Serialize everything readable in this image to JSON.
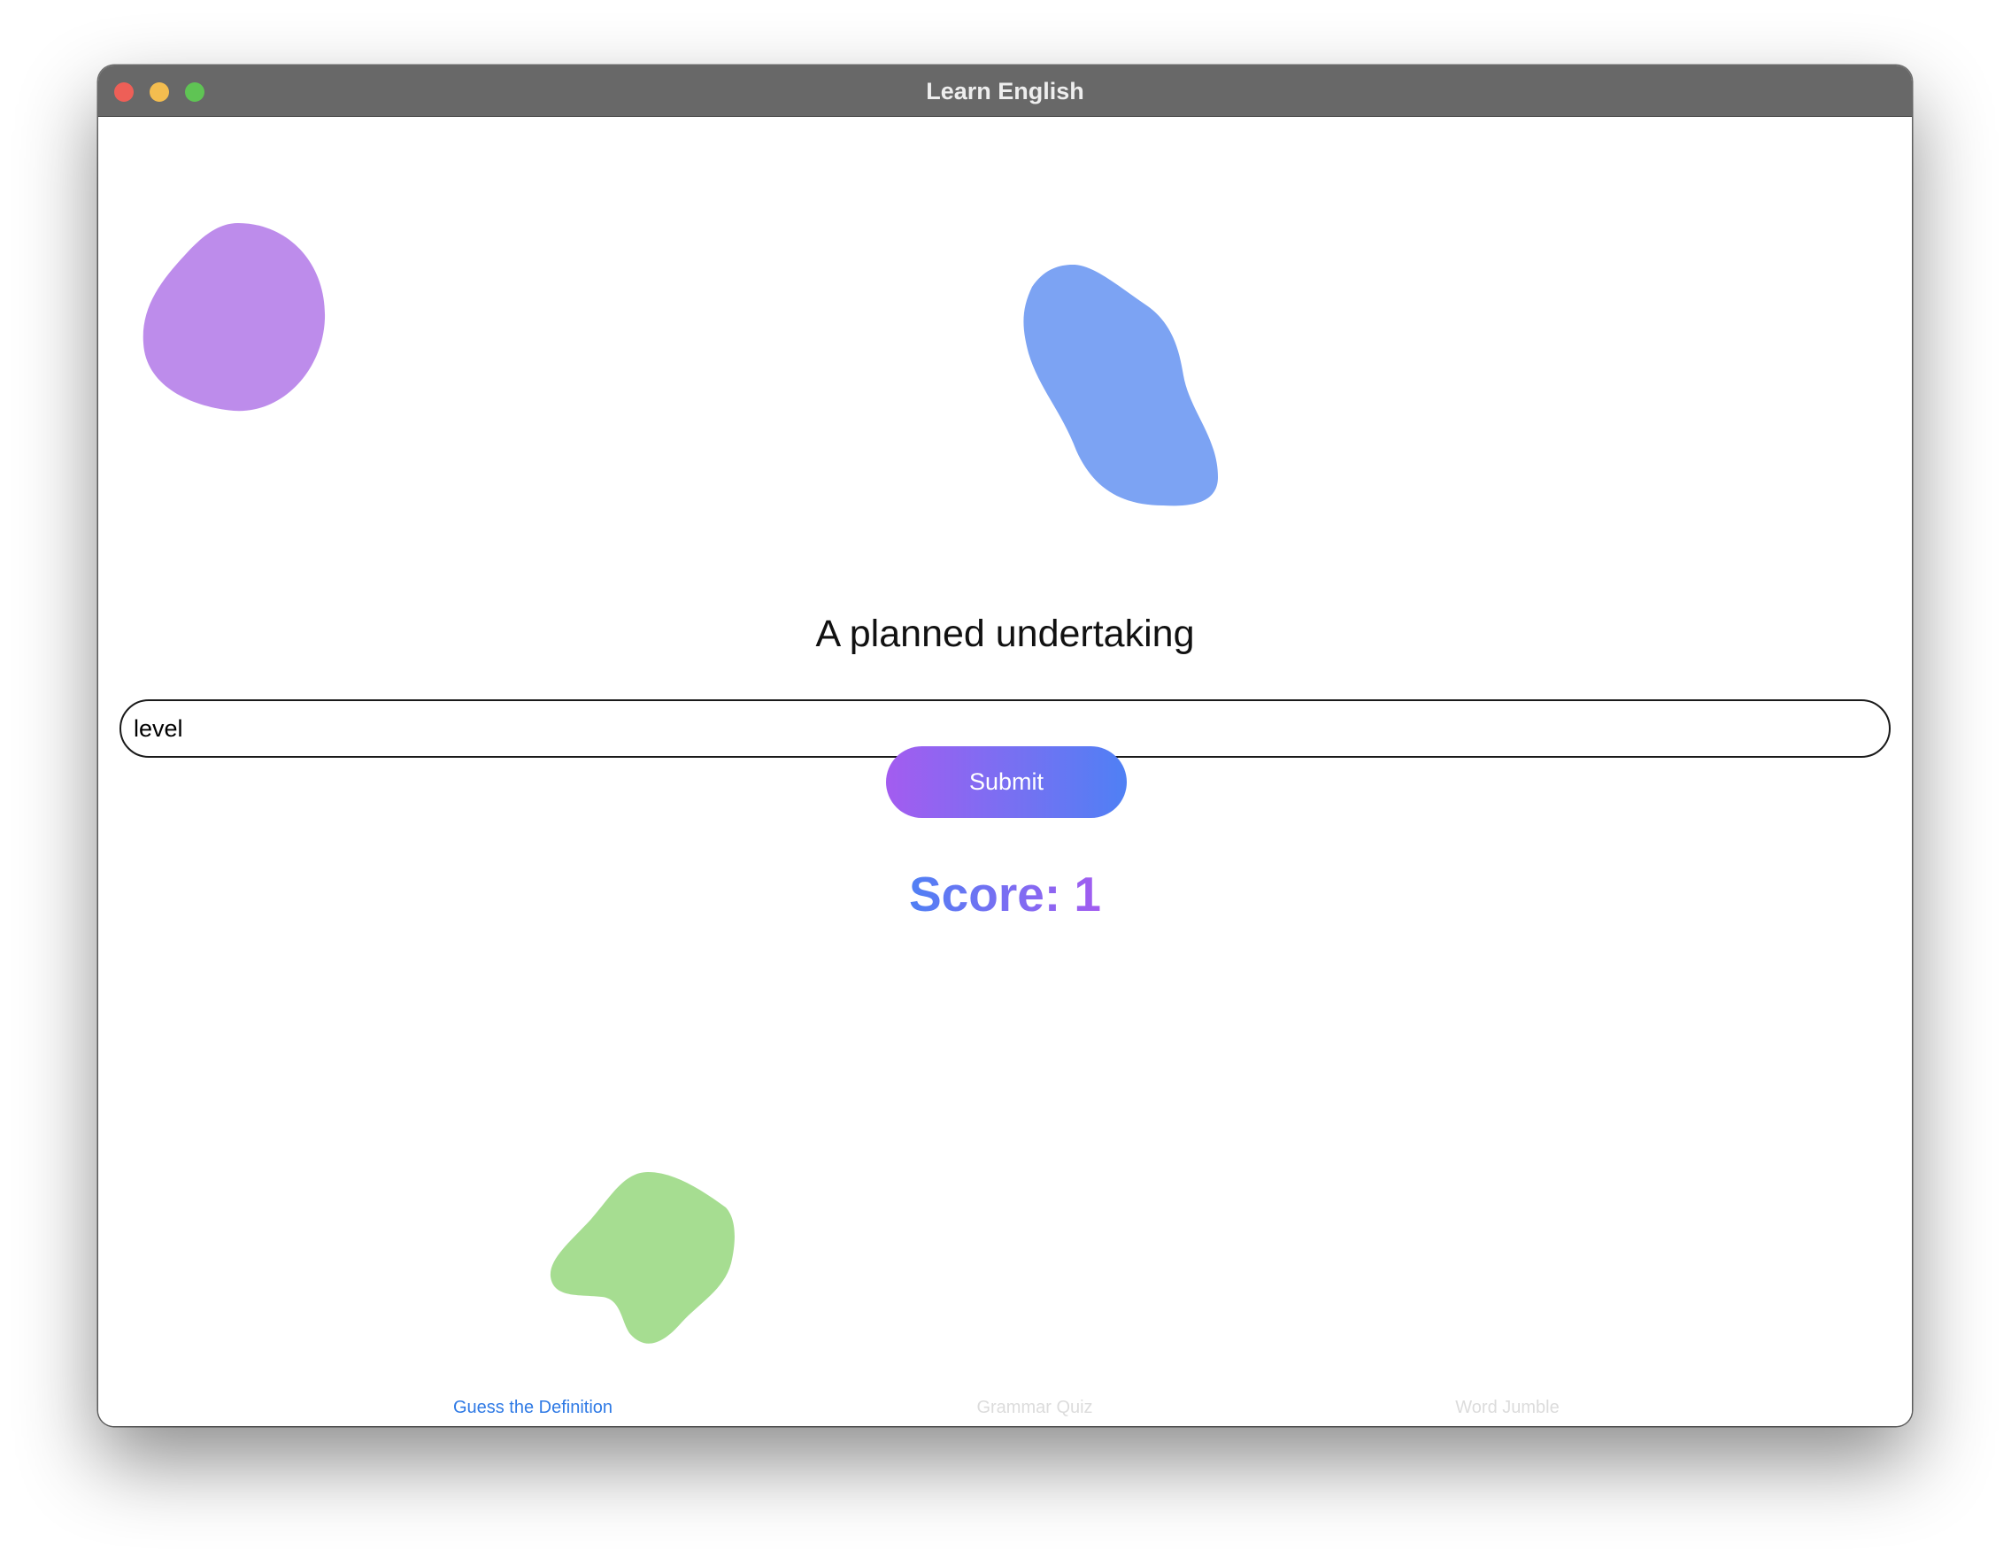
{
  "window": {
    "title": "Learn English"
  },
  "quiz": {
    "prompt": "A planned undertaking",
    "answer_value": "level",
    "submit_label": "Submit",
    "score_text": "Score: 1"
  },
  "tabs": [
    {
      "label": "Guess the Definition",
      "active": true
    },
    {
      "label": "Grammar Quiz",
      "active": false
    },
    {
      "label": "Word Jumble",
      "active": false
    }
  ],
  "colors": {
    "blob_purple": "#bd8ceb",
    "blob_blue": "#7ca3f3",
    "blob_green": "#a6dd91",
    "accent_start": "#a35cf0",
    "accent_end": "#4f80f4",
    "tab_active": "#2f7ae5"
  }
}
